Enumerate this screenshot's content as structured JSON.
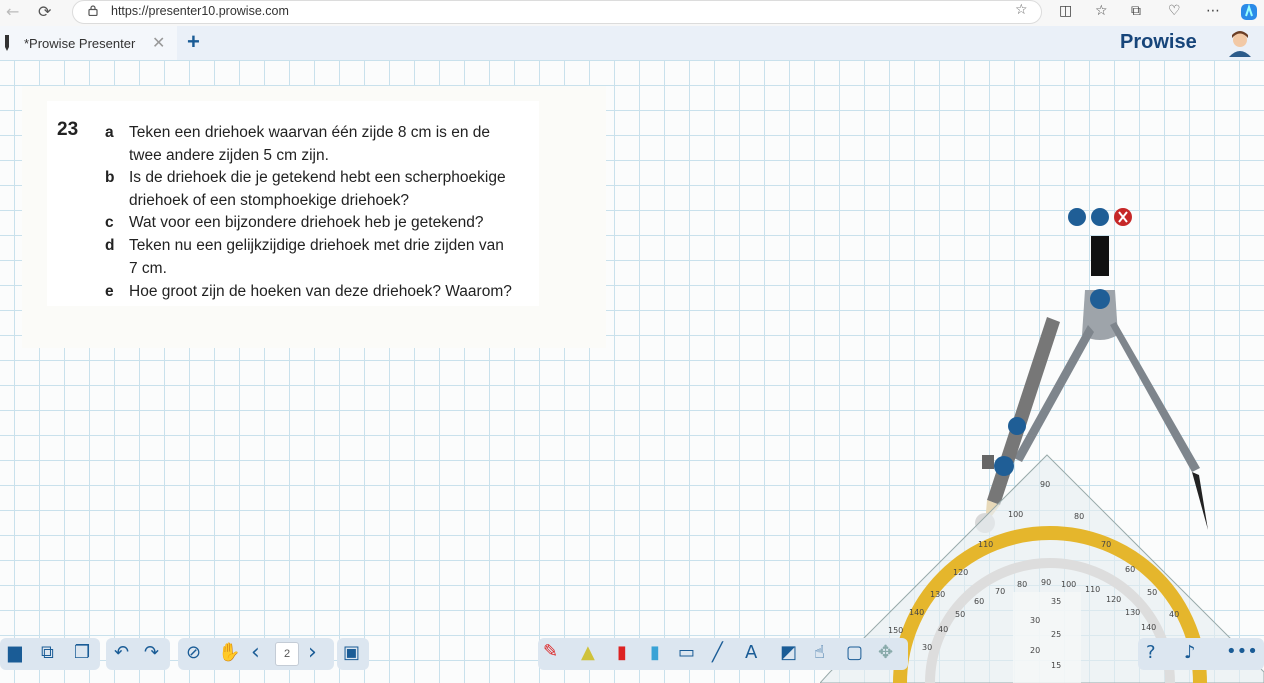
{
  "browser": {
    "url": "https://presenter10.prowise.com"
  },
  "app": {
    "tab_title": "*Prowise Presenter",
    "tab_close": "✕",
    "tab_add": "+",
    "logo_text": "Prowise",
    "brand_color": "#17457a",
    "grid_color": "#c9e1ec"
  },
  "question": {
    "number": "23",
    "items": [
      {
        "letter": "a",
        "lines": [
          "Teken een driehoek waarvan één zijde 8 cm is en de",
          "twee andere zijden 5 cm zijn."
        ]
      },
      {
        "letter": "b",
        "lines": [
          "Is de driehoek die je getekend hebt een scherphoekige",
          "driehoek of een stomphoekige driehoek?"
        ]
      },
      {
        "letter": "c",
        "lines": [
          "Wat voor een bijzondere driehoek heb je getekend?"
        ]
      },
      {
        "letter": "d",
        "lines": [
          "Teken nu een gelijkzijdige driehoek met drie zijden van",
          "7 cm."
        ]
      },
      {
        "letter": "e",
        "lines": [
          "Hoe groot zijn de hoeken van deze driehoek? Waarom?"
        ]
      }
    ]
  },
  "toolbar": {
    "page_number": "2",
    "prev": "‹",
    "next": "›"
  },
  "protractor": {
    "outer_ticks": [
      "90",
      "100",
      "110",
      "120",
      "130",
      "140",
      "150",
      "80",
      "70",
      "60",
      "50",
      "40"
    ],
    "ring_ticks": [
      "90",
      "100",
      "80",
      "110",
      "70",
      "120",
      "60",
      "130",
      "50",
      "140",
      "40",
      "150",
      "30"
    ],
    "ruler_ticks": [
      "35",
      "30",
      "25",
      "20",
      "15"
    ]
  }
}
